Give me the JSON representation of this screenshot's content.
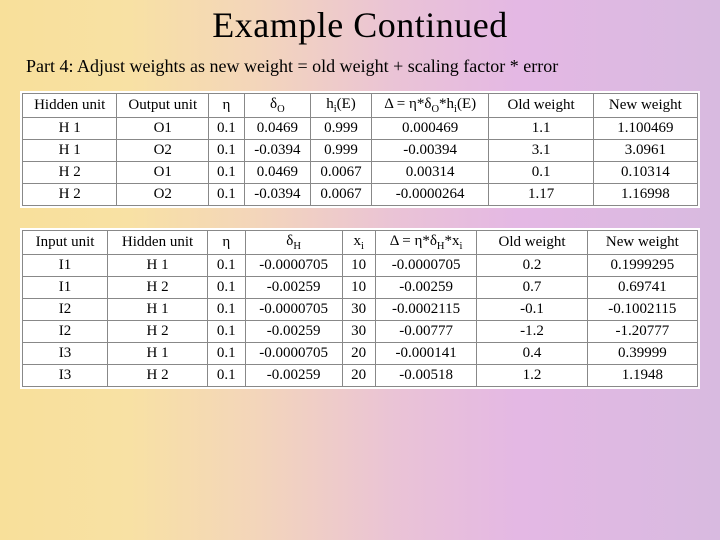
{
  "title": "Example Continued",
  "subtitle": "Part 4:  Adjust weights as new weight = old weight + scaling factor * error",
  "table1": {
    "headers": [
      "Hidden unit",
      "Output unit",
      "η",
      "δ_O",
      "h_i(E)",
      "Δ = η*δ_O*h_i(E)",
      "Old weight",
      "New weight"
    ],
    "rows": [
      [
        "H 1",
        "O1",
        "0.1",
        "0.0469",
        "0.999",
        "0.000469",
        "1.1",
        "1.100469"
      ],
      [
        "H 1",
        "O2",
        "0.1",
        "-0.0394",
        "0.999",
        "-0.00394",
        "3.1",
        "3.0961"
      ],
      [
        "H 2",
        "O1",
        "0.1",
        "0.0469",
        "0.0067",
        "0.00314",
        "0.1",
        "0.10314"
      ],
      [
        "H 2",
        "O2",
        "0.1",
        "-0.0394",
        "0.0067",
        "-0.0000264",
        "1.17",
        "1.16998"
      ]
    ]
  },
  "table2": {
    "headers": [
      "Input unit",
      "Hidden unit",
      "η",
      "δ_H",
      "x_i",
      "Δ = η*δ_H*x_i",
      "Old weight",
      "New weight"
    ],
    "rows": [
      [
        "I1",
        "H 1",
        "0.1",
        "-0.0000705",
        "10",
        "-0.0000705",
        "0.2",
        "0.1999295"
      ],
      [
        "I1",
        "H 2",
        "0.1",
        "-0.00259",
        "10",
        "-0.00259",
        "0.7",
        "0.69741"
      ],
      [
        "I2",
        "H 1",
        "0.1",
        "-0.0000705",
        "30",
        "-0.0002115",
        "-0.1",
        "-0.1002115"
      ],
      [
        "I2",
        "H 2",
        "0.1",
        "-0.00259",
        "30",
        "-0.00777",
        "-1.2",
        "-1.20777"
      ],
      [
        "I3",
        "H 1",
        "0.1",
        "-0.0000705",
        "20",
        "-0.000141",
        "0.4",
        "0.39999"
      ],
      [
        "I3",
        "H 2",
        "0.1",
        "-0.00259",
        "20",
        "-0.00518",
        "1.2",
        "1.1948"
      ]
    ]
  }
}
